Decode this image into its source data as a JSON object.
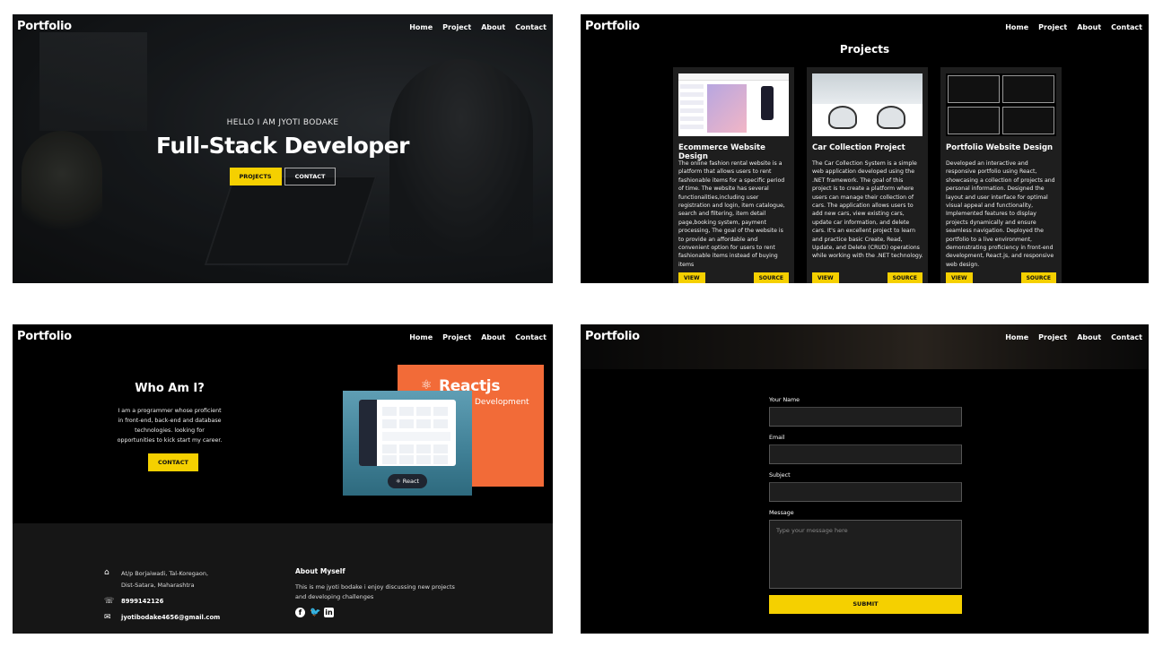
{
  "brand": "Portfolio",
  "nav": [
    "Home",
    "Project",
    "About",
    "Contact"
  ],
  "hero": {
    "subtitle": "HELLO I AM JYOTI BODAKE",
    "title": "Full-Stack Developer",
    "btn_projects": "PROJECTS",
    "btn_contact": "CONTACT"
  },
  "projects": {
    "title": "Projects",
    "cards": [
      {
        "title": "Ecommerce Website Design",
        "desc": "The online fashion rental website is a platform that allows users to rent fashionable items for a specific period of time. The website has several functionalities,including user registration and login, item catalogue, search and filtering, item detail page,booking system, payment processing, The goal of the website is to provide an affordable and convenient option for users to rent fashionable items instead of buying items",
        "view": "VIEW",
        "source": "SOURCE"
      },
      {
        "title": "Car Collection Project",
        "desc": "The Car Collection System is a simple web application developed using the .NET framework. The goal of this project is to create a platform where users can manage their collection of cars. The application allows users to add new cars, view existing cars, update car information, and delete cars. It's an excellent project to learn and practice basic Create, Read, Update, and Delete (CRUD) operations while working with the .NET technology.",
        "view": "VIEW",
        "source": "SOURCE"
      },
      {
        "title": "Portfolio Website Design",
        "desc": "Developed an interactive and responsive portfolio using React, showcasing a collection of projects and personal information. Designed the layout and user interface for optimal visual appeal and functionality, Implemented features to display projects dynamically and ensure seamless navigation. Deployed the portfolio to a live environment, demonstrating proficiency in front-end development, React.js, and responsive web design.",
        "view": "VIEW",
        "source": "SOURCE"
      }
    ]
  },
  "about": {
    "title": "Who Am I?",
    "text": "I am a programmer whose proficient in front-end, back-end and database technologies. looking for opportunities to kick start my career.",
    "btn": "CONTACT",
    "react_title": "Reactjs",
    "react_sub": "Development",
    "react_pill": "React"
  },
  "footer": {
    "addr1": "At/p Borjaiwadi, Tal-Koregaon,",
    "addr2": "Dist-Satara, Maharashtra",
    "phone": "8999142126",
    "email": "jyotibodake4656@gmail.com",
    "about_title": "About Myself",
    "about_desc": "This is me jyoti bodake i enjoy discussing new projects and developing challenges"
  },
  "contact": {
    "name_label": "Your Name",
    "email_label": "Email",
    "subject_label": "Subject",
    "message_label": "Message",
    "message_placeholder": "Type your message here",
    "submit": "SUBMIT"
  },
  "colors": {
    "accent": "#f5d000",
    "panel_bg": "#000000",
    "card_bg": "#1e1e1e",
    "react_bg": "#f26b38"
  },
  "icons": [
    "home-icon",
    "phone-icon",
    "mail-icon",
    "facebook-icon",
    "twitter-icon",
    "linkedin-icon",
    "react-icon"
  ]
}
